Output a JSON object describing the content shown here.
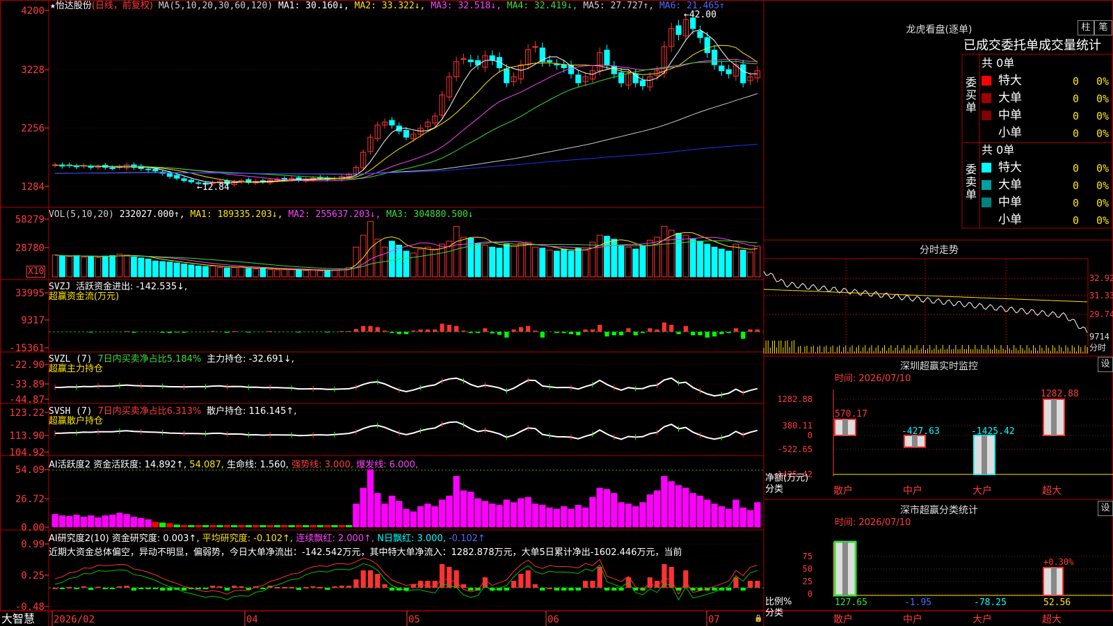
{
  "colors": {
    "up": "#ff3232",
    "down": "#00ffff",
    "grid": "#b00000",
    "axis": "#ff3b3b",
    "ma1": "#ffffff",
    "ma2": "#ffe600",
    "ma3": "#ff40ff",
    "ma4": "#36e036",
    "ma5": "#c8c8c8",
    "ma6": "#2030ff"
  },
  "chart_data": [
    {
      "type": "candlestick",
      "id": "price",
      "header": {
        "star": "★",
        "name": "怡达股份",
        "mode": "(日线，前复权)",
        "ma_label": "MA(5,10,20,30,60,120)",
        "ma1": "MA1: 30.160↓,",
        "ma2": "MA2: 33.322↓,",
        "ma3": "MA3: 32.518↓,",
        "ma4": "MA4: 32.419↓,",
        "ma5": "MA5: 27.727↑,",
        "ma6": "MA6: 21.465↑"
      },
      "yticks": [
        "4200",
        "3228",
        "2256",
        "1284"
      ],
      "ylim": [
        1100,
        4250
      ],
      "annotations": {
        "high": "42.00",
        "low": "12.84",
        "high_arrow": "←",
        "low_arrow": "←"
      },
      "x_labels": [
        "2026/02",
        "04",
        "05",
        "06",
        "07"
      ],
      "closes": [
        1640,
        1620,
        1630,
        1610,
        1630,
        1600,
        1615,
        1600,
        1590,
        1610,
        1640,
        1600,
        1580,
        1560,
        1540,
        1500,
        1450,
        1420,
        1380,
        1360,
        1340,
        1320,
        1350,
        1370,
        1330,
        1360,
        1380,
        1350,
        1370,
        1360,
        1390,
        1400,
        1410,
        1420,
        1390,
        1400,
        1420,
        1430,
        1400,
        1420,
        1450,
        1480,
        1600,
        1850,
        2100,
        2300,
        2350,
        2300,
        2200,
        2100,
        2150,
        2250,
        2350,
        2450,
        2800,
        3100,
        3350,
        3400,
        3350,
        3300,
        3450,
        3380,
        3250,
        3000,
        3100,
        3300,
        3550,
        3600,
        3350,
        3350,
        3300,
        3250,
        3150,
        3000,
        3100,
        3200,
        3500,
        3300,
        3150,
        3000,
        3150,
        3000,
        2950,
        3100,
        3200,
        3600,
        3900,
        3800,
        4050,
        3900,
        3750,
        3500,
        3300,
        3200,
        3150,
        3300,
        3000,
        3100,
        3200
      ],
      "volumes": [
        22000,
        21000,
        20500,
        21500,
        20000,
        21000,
        19500,
        21000,
        21500,
        23000,
        22000,
        20000,
        19000,
        18000,
        16000,
        15500,
        15000,
        14000,
        13000,
        12000,
        11000,
        10500,
        11000,
        9500,
        9000,
        9500,
        10000,
        8500,
        8000,
        8500,
        7500,
        7000,
        7500,
        7200,
        7000,
        6500,
        7000,
        6000,
        6200,
        7000,
        8000,
        9500,
        30000,
        42000,
        56000,
        38000,
        30000,
        36000,
        32000,
        26000,
        24000,
        28000,
        30000,
        28000,
        33000,
        36000,
        51000,
        40000,
        39000,
        34000,
        32000,
        30000,
        29000,
        33000,
        31000,
        34000,
        35000,
        30000,
        29000,
        27000,
        26000,
        28000,
        26000,
        29000,
        27000,
        35000,
        42000,
        41000,
        38000,
        31000,
        30000,
        28000,
        31000,
        37000,
        40000,
        51000,
        47000,
        44000,
        42000,
        38000,
        36000,
        33000,
        30000,
        28000,
        26000,
        33000,
        27000,
        25000,
        31000
      ]
    },
    {
      "type": "bar",
      "id": "vol",
      "header": {
        "label": "VOL(5,10,20)",
        "value": "232027.000↑,",
        "ma1": "MA1: 189335.203↓,",
        "ma2": "MA2: 255637.203↓,",
        "ma3": "MA3: 304880.500↓"
      },
      "yticks": [
        "58279",
        "28780"
      ],
      "unit": "X10"
    },
    {
      "type": "bar",
      "id": "svzj",
      "header": {
        "label": "SVZJ",
        "desc": "活跃资金进出: -142.535↓,",
        "sub": "超赢资金流(万元)"
      },
      "yticks": [
        "33995",
        "9317",
        "-15361"
      ]
    },
    {
      "type": "line",
      "id": "svzl",
      "header": {
        "label": "SVZL (7)",
        "desc": "7日内买卖净占比5.184%",
        "val": "主力持仓: -32.691↓,",
        "sub": "超赢主力持仓"
      },
      "yticks": [
        "-22.90",
        "-33.89",
        "-44.87"
      ]
    },
    {
      "type": "line",
      "id": "svsh",
      "header": {
        "label": "SVSH (7)",
        "desc": "7日内买卖净占比6.313%",
        "val": "散户持仓: 116.145↑,",
        "sub": "超赢散户持仓"
      },
      "yticks": [
        "123.22",
        "113.90",
        "104.92"
      ]
    },
    {
      "type": "bar",
      "id": "ai1",
      "header": {
        "label": "AI活跃度2",
        "v1": "资金活跃度: 14.892↑,",
        "v2": "54.087,",
        "v3": "生命线: 1.560,",
        "v4": "强势线: 3.000,",
        "v5": "爆发线: 6.000,"
      },
      "yticks": [
        "54.09",
        "26.72",
        "0.00"
      ]
    },
    {
      "type": "bar",
      "id": "ai2",
      "header": {
        "label": "AI研究度2(10)",
        "v1": "资金研究度: 0.003↑,",
        "v2": "平均研究度: -0.102↑,",
        "v3": "连续飘红: 2.000↑,",
        "v4": "N日飘红: 3.000,",
        "v5": "-0.102↑",
        "text": "近期大资金总体偏空，异动不明显，偏弱势，今日大单净流出：-142.542万元，其中特大单净流入：1282.878万元，大单5日累计净出-1602.446万元，当前"
      },
      "yticks": [
        "0.99",
        "0.25",
        "-0.48"
      ]
    }
  ],
  "footer": {
    "brand": "大智慧",
    "lock": "🔒"
  },
  "right": {
    "lhb_title": "龙虎看盘(逐单)",
    "tab_zhu": "柱",
    "tab_bi": "笔",
    "headline": "已成交委托单成交量统计",
    "buy": {
      "side": "委买单",
      "total": "共 0单",
      "rows": [
        {
          "name": "特大",
          "v": "0",
          "p": "0%",
          "c": "#ff0000"
        },
        {
          "name": "大单",
          "v": "0",
          "p": "0%",
          "c": "#a00000"
        },
        {
          "name": "中单",
          "v": "0",
          "p": "0%",
          "c": "#800000"
        },
        {
          "name": "小单",
          "v": "0",
          "p": "0%",
          "c": "#000000"
        }
      ]
    },
    "sell": {
      "side": "委卖单",
      "total": "共 0单",
      "rows": [
        {
          "name": "特大",
          "v": "0",
          "p": "0%",
          "c": "#00ffff"
        },
        {
          "name": "大单",
          "v": "0",
          "p": "0%",
          "c": "#00a0a0"
        },
        {
          "name": "中单",
          "v": "0",
          "p": "0%",
          "c": "#008080"
        },
        {
          "name": "小单",
          "v": "0",
          "p": "0%",
          "c": "#000000"
        }
      ]
    },
    "fenshi": {
      "title": "分时走势",
      "yticks": [
        "32.92",
        "31.33",
        "29.74"
      ],
      "vol_label": "9714",
      "unit": "分时"
    },
    "monitor": {
      "title": "深圳超赢实时监控",
      "set": "设",
      "time": "时间: 2026/07/10",
      "yticks": [
        "1282.88",
        "380.11",
        "0",
        "-522.65",
        "-1425.42"
      ],
      "ylabel": "净额(万元)",
      "xlabel": "分类",
      "chart_data": {
        "type": "bar",
        "categories": [
          "散户",
          "中户",
          "大户",
          "超大"
        ],
        "values": [
          570.17,
          -427.63,
          -1425.42,
          1282.88
        ],
        "labels": [
          "570.17",
          "-427.63",
          "-1425.42",
          "1282.88"
        ],
        "ylim": [
          -1425.42,
          1282.88
        ]
      }
    },
    "stat": {
      "title": "深市超赢分类统计",
      "set": "设",
      "time": "时间: 2026/07/10",
      "yticks": [
        "75",
        "50",
        "25",
        "0"
      ],
      "ylabel": "比例%",
      "xlabel": "分类",
      "chart_data": {
        "type": "bar",
        "categories": [
          "散户",
          "中户",
          "大户",
          "超大"
        ],
        "values": [
          127.65,
          -1.95,
          -78.25,
          52.56
        ],
        "labels": [
          "127.65",
          "-1.95",
          "-78.25",
          "52.56"
        ],
        "extra": "+0.30%"
      }
    }
  }
}
